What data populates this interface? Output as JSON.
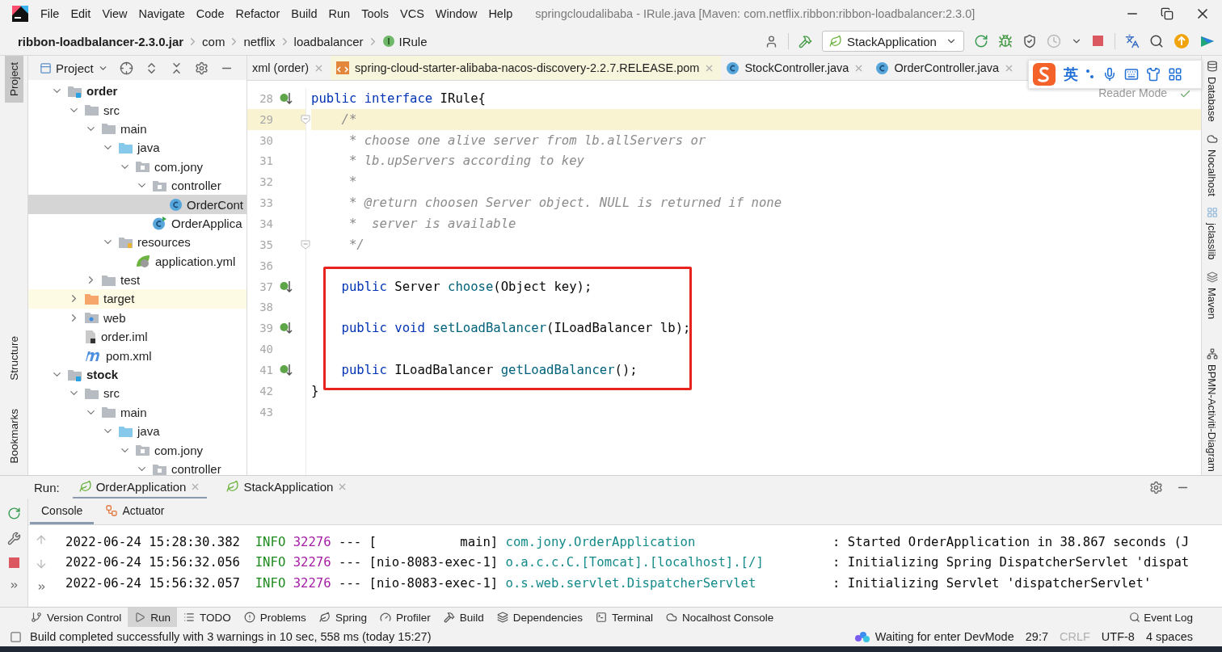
{
  "menu_bar": {
    "items": [
      "File",
      "Edit",
      "View",
      "Navigate",
      "Code",
      "Refactor",
      "Build",
      "Run",
      "Tools",
      "VCS",
      "Window",
      "Help"
    ],
    "title": "springcloudalibaba - IRule.java [Maven: com.netflix.ribbon:ribbon-loadbalancer:2.3.0]"
  },
  "breadcrumb": [
    {
      "label": "ribbon-loadbalancer-2.3.0.jar",
      "kind": "jar"
    },
    {
      "label": "com",
      "kind": "package"
    },
    {
      "label": "netflix",
      "kind": "package"
    },
    {
      "label": "loadbalancer",
      "kind": "package"
    },
    {
      "label": "IRule",
      "kind": "interface"
    }
  ],
  "toolbar": {
    "run_config": "StackApplication"
  },
  "left_stripe": [
    {
      "label": "Project",
      "selected": true
    },
    {
      "label": "Structure",
      "selected": false
    },
    {
      "label": "Bookmarks",
      "selected": false
    }
  ],
  "project_panel": {
    "title": "Project",
    "tree": [
      {
        "label": "order",
        "kind": "module",
        "expanded": true,
        "selected": false,
        "children": [
          {
            "label": "src",
            "kind": "folder",
            "expanded": true,
            "selected": false,
            "children": [
              {
                "label": "main",
                "kind": "folder",
                "expanded": true,
                "selected": false,
                "children": [
                  {
                    "label": "java",
                    "kind": "source",
                    "expanded": true,
                    "selected": false,
                    "children": [
                      {
                        "label": "com.jony",
                        "kind": "package",
                        "expanded": true,
                        "selected": false,
                        "children": [
                          {
                            "label": "controller",
                            "kind": "package",
                            "expanded": true,
                            "selected": false,
                            "children": [
                              {
                                "label": "OrderCont",
                                "kind": "class",
                                "selected": true
                              }
                            ]
                          },
                          {
                            "label": "OrderApplica",
                            "kind": "app",
                            "selected": false
                          }
                        ]
                      }
                    ]
                  },
                  {
                    "label": "resources",
                    "kind": "resources",
                    "expanded": true,
                    "selected": false,
                    "children": [
                      {
                        "label": "application.yml",
                        "kind": "yaml",
                        "selected": false
                      }
                    ]
                  }
                ]
              },
              {
                "label": "test",
                "kind": "folder",
                "expanded": false,
                "selected": false
              }
            ]
          },
          {
            "label": "target",
            "kind": "excluded",
            "expanded": false,
            "selected": false
          },
          {
            "label": "web",
            "kind": "web",
            "expanded": false,
            "selected": false
          },
          {
            "label": "order.iml",
            "kind": "iml",
            "selected": false
          },
          {
            "label": "pom.xml",
            "kind": "maven",
            "selected": false
          }
        ]
      },
      {
        "label": "stock",
        "kind": "module",
        "expanded": true,
        "selected": false,
        "children": [
          {
            "label": "src",
            "kind": "folder",
            "expanded": true,
            "selected": false,
            "children": [
              {
                "label": "main",
                "kind": "folder",
                "expanded": true,
                "selected": false,
                "children": [
                  {
                    "label": "java",
                    "kind": "source",
                    "expanded": true,
                    "selected": false,
                    "children": [
                      {
                        "label": "com.jony",
                        "kind": "package",
                        "expanded": true,
                        "selected": false,
                        "children": [
                          {
                            "label": "controller",
                            "kind": "package",
                            "expanded": true,
                            "selected": false
                          }
                        ]
                      }
                    ]
                  }
                ]
              }
            ]
          }
        ]
      }
    ]
  },
  "editor": {
    "tabs": [
      {
        "label": "xml (order)",
        "kind": "xml",
        "selected": false
      },
      {
        "label": "spring-cloud-starter-alibaba-nacos-discovery-2.2.7.RELEASE.pom",
        "kind": "pom",
        "selected": false
      },
      {
        "label": "StockController.java",
        "kind": "class",
        "selected": false
      },
      {
        "label": "OrderController.java",
        "kind": "class",
        "selected": false
      }
    ],
    "reader_mode": "Reader Mode",
    "lines": [
      {
        "number": "28",
        "current": false,
        "boxed": false,
        "gutter": {
          "kind": "implemented"
        },
        "tokens": [
          {
            "kind": "keyword",
            "text": "public interface"
          },
          {
            "kind": "plain",
            "text": " IRule{"
          }
        ]
      },
      {
        "number": "29",
        "current": true,
        "boxed": false,
        "gutter": {
          "kind": "fold"
        },
        "tokens": [
          {
            "kind": "comment",
            "text": "    /*"
          }
        ]
      },
      {
        "number": "30",
        "current": false,
        "boxed": false,
        "tokens": [
          {
            "kind": "comment",
            "text": "     * choose one alive server from lb.allServers or"
          }
        ]
      },
      {
        "number": "31",
        "current": false,
        "boxed": false,
        "tokens": [
          {
            "kind": "comment",
            "text": "     * lb.upServers according to key"
          }
        ]
      },
      {
        "number": "32",
        "current": false,
        "boxed": false,
        "tokens": [
          {
            "kind": "comment",
            "text": "     *"
          }
        ]
      },
      {
        "number": "33",
        "current": false,
        "boxed": false,
        "tokens": [
          {
            "kind": "comment",
            "text": "     * @return choosen Server object. NULL is returned if none"
          }
        ]
      },
      {
        "number": "34",
        "current": false,
        "boxed": false,
        "tokens": [
          {
            "kind": "comment",
            "text": "     *  server is available"
          }
        ]
      },
      {
        "number": "35",
        "current": false,
        "boxed": false,
        "gutter": {
          "kind": "fold"
        },
        "tokens": [
          {
            "kind": "comment",
            "text": "     */"
          }
        ]
      },
      {
        "number": "36",
        "current": false,
        "boxed": false
      },
      {
        "number": "37",
        "current": false,
        "boxed": true,
        "gutter": {
          "kind": "implemented"
        },
        "tokens": [
          {
            "kind": "keyword",
            "text": "    public"
          },
          {
            "kind": "plain",
            "text": " Server "
          },
          {
            "kind": "method",
            "text": "choose"
          },
          {
            "kind": "plain",
            "text": "(Object key);"
          }
        ]
      },
      {
        "number": "38",
        "current": false,
        "boxed": true
      },
      {
        "number": "39",
        "current": false,
        "boxed": true,
        "gutter": {
          "kind": "implemented"
        },
        "tokens": [
          {
            "kind": "keyword",
            "text": "    public void "
          },
          {
            "kind": "method",
            "text": "setLoadBalancer"
          },
          {
            "kind": "plain",
            "text": "(ILoadBalancer lb);"
          }
        ]
      },
      {
        "number": "40",
        "current": false,
        "boxed": true
      },
      {
        "number": "41",
        "current": false,
        "boxed": true,
        "gutter": {
          "kind": "implemented"
        },
        "tokens": [
          {
            "kind": "keyword",
            "text": "    public"
          },
          {
            "kind": "plain",
            "text": " ILoadBalancer "
          },
          {
            "kind": "method",
            "text": "getLoadBalancer"
          },
          {
            "kind": "plain",
            "text": "();"
          }
        ]
      },
      {
        "number": "42",
        "current": false,
        "boxed": false,
        "tokens": [
          {
            "kind": "plain",
            "text": "}"
          }
        ]
      },
      {
        "number": "43",
        "current": false,
        "boxed": false
      }
    ]
  },
  "right_stripe": [
    {
      "label": "Database",
      "kind": "database"
    },
    {
      "label": "Nocalhost",
      "kind": "nocalhost"
    },
    {
      "label": "jclasslib",
      "kind": "jclasslib"
    },
    {
      "label": "Maven",
      "kind": "maven"
    },
    {
      "label": "BPMN-Activiti-Diagram",
      "kind": "bpmn"
    }
  ],
  "run_panel": {
    "label": "Run:",
    "tabs": [
      {
        "label": "OrderApplication",
        "selected": true
      },
      {
        "label": "StackApplication",
        "selected": false
      }
    ],
    "subtabs": [
      {
        "label": "Console",
        "selected": true
      },
      {
        "label": "Actuator",
        "selected": false
      }
    ],
    "log": [
      {
        "time": "2022-06-24 15:28:30.382",
        "level": "INFO",
        "pid": "32276",
        "sep": "---",
        "thread": "[           main]",
        "logger": "com.jony.OrderApplication",
        "message": ": Started OrderApplication in 38.867 seconds (J"
      },
      {
        "time": "2022-06-24 15:56:32.056",
        "level": "INFO",
        "pid": "32276",
        "sep": "---",
        "thread": "[nio-8083-exec-1]",
        "logger": "o.a.c.c.C.[Tomcat].[localhost].[/]",
        "message": ": Initializing Spring DispatcherServlet 'dispat"
      },
      {
        "time": "2022-06-24 15:56:32.057",
        "level": "INFO",
        "pid": "32276",
        "sep": "---",
        "thread": "[nio-8083-exec-1]",
        "logger": "o.s.web.servlet.DispatcherServlet",
        "message": ": Initializing Servlet 'dispatcherServlet'"
      }
    ]
  },
  "tool_windows": [
    {
      "label": "Version Control",
      "kind": "vcs",
      "selected": false
    },
    {
      "label": "Run",
      "kind": "run",
      "selected": true
    },
    {
      "label": "TODO",
      "kind": "todo",
      "selected": false
    },
    {
      "label": "Problems",
      "kind": "problems",
      "selected": false
    },
    {
      "label": "Spring",
      "kind": "spring",
      "selected": false
    },
    {
      "label": "Profiler",
      "kind": "profiler",
      "selected": false
    },
    {
      "label": "Build",
      "kind": "build",
      "selected": false
    },
    {
      "label": "Dependencies",
      "kind": "dependencies",
      "selected": false
    },
    {
      "label": "Terminal",
      "kind": "terminal",
      "selected": false
    },
    {
      "label": "Nocalhost Console",
      "kind": "nocalhost",
      "selected": false
    }
  ],
  "event_log": "Event Log",
  "status_bar": {
    "message": "Build completed successfully with 3 warnings in 10 sec, 558 ms (today 15:27)",
    "items": [
      {
        "text": "Waiting for enter DevMode",
        "kind": "devmode",
        "disabled": false
      },
      {
        "text": "29:7",
        "kind": "position",
        "disabled": false
      },
      {
        "text": "CRLF",
        "kind": "separator",
        "disabled": true
      },
      {
        "text": "UTF-8",
        "kind": "encoding",
        "disabled": false
      },
      {
        "text": "4 spaces",
        "kind": "indent",
        "disabled": false
      }
    ]
  },
  "ime_bar": {
    "language": "英"
  }
}
